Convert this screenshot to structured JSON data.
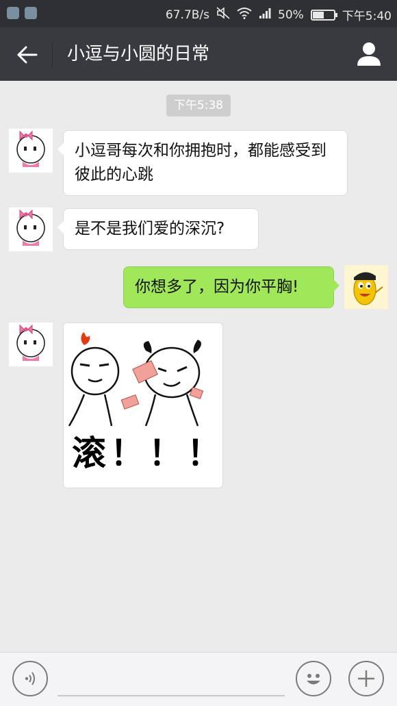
{
  "status_bar": {
    "network_speed": "67.7B/s",
    "battery_percent": "50%",
    "battery_level": 0.5,
    "time": "下午5:40",
    "icons": [
      "app-notification-icon",
      "app-notification-icon",
      "mute-icon",
      "wifi-icon",
      "signal-icon",
      "battery-icon"
    ]
  },
  "header": {
    "title": "小逗与小圆的日常",
    "back_icon": "arrow-left-icon",
    "profile_icon": "person-icon"
  },
  "chat": {
    "timestamp": "下午5:38",
    "messages": [
      {
        "direction": "incoming",
        "type": "text",
        "text": "小逗哥每次和你拥抱时，都能感受到彼此的心跳",
        "avatar": "bow-girl-avatar"
      },
      {
        "direction": "incoming",
        "type": "text",
        "text": "是不是我们爱的深沉?",
        "avatar": "bow-girl-avatar"
      },
      {
        "direction": "outgoing",
        "type": "text",
        "text": "你想多了，因为你平胸!",
        "avatar": "yellow-bean-avatar"
      },
      {
        "direction": "incoming",
        "type": "sticker",
        "text": "滚！！！",
        "avatar": "bow-girl-avatar"
      }
    ]
  },
  "input_bar": {
    "voice_icon": "voice-icon",
    "emoji_icon": "emoji-icon",
    "plus_icon": "plus-icon",
    "text_value": ""
  },
  "colors": {
    "status_bar_bg": "#2f3033",
    "title_bar_bg": "#393a3f",
    "chat_bg": "#ebebeb",
    "outgoing_bubble": "#a0e75a",
    "incoming_bubble": "#ffffff"
  }
}
